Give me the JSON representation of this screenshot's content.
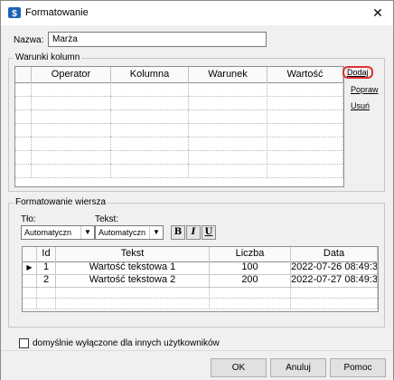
{
  "window": {
    "title": "Formatowanie",
    "close": "✕"
  },
  "name_field": {
    "label": "Nazwa:",
    "value": "Marża"
  },
  "conditions": {
    "group_title": "Warunki kolumn",
    "columns": [
      "",
      "Operator",
      "Kolumna",
      "Warunek",
      "Wartość"
    ],
    "actions": {
      "add": "Dodaj",
      "edit": "Popraw",
      "delete": "Usuń"
    }
  },
  "row_format": {
    "group_title": "Formatowanie wiersza",
    "background_label": "Tło:",
    "background_value": "Automatyczn",
    "text_label": "Tekst:",
    "text_value": "Automatyczn",
    "bold": "B",
    "italic": "I",
    "underline": "U",
    "table": {
      "columns": [
        "",
        "Id",
        "Tekst",
        "Liczba",
        "Data"
      ],
      "rows": [
        {
          "marker": "▶",
          "id": "1",
          "text": "Wartość tekstowa 1",
          "number": "100",
          "date": "2022-07-26 08:49:3"
        },
        {
          "marker": "",
          "id": "2",
          "text": "Wartość tekstowa 2",
          "number": "200",
          "date": "2022-07-27 08:49:3"
        }
      ]
    }
  },
  "disabled_checkbox_label": "domyślnie wyłączone dla innych użytkowników",
  "buttons": {
    "ok": "OK",
    "cancel": "Anuluj",
    "help": "Pomoc"
  }
}
